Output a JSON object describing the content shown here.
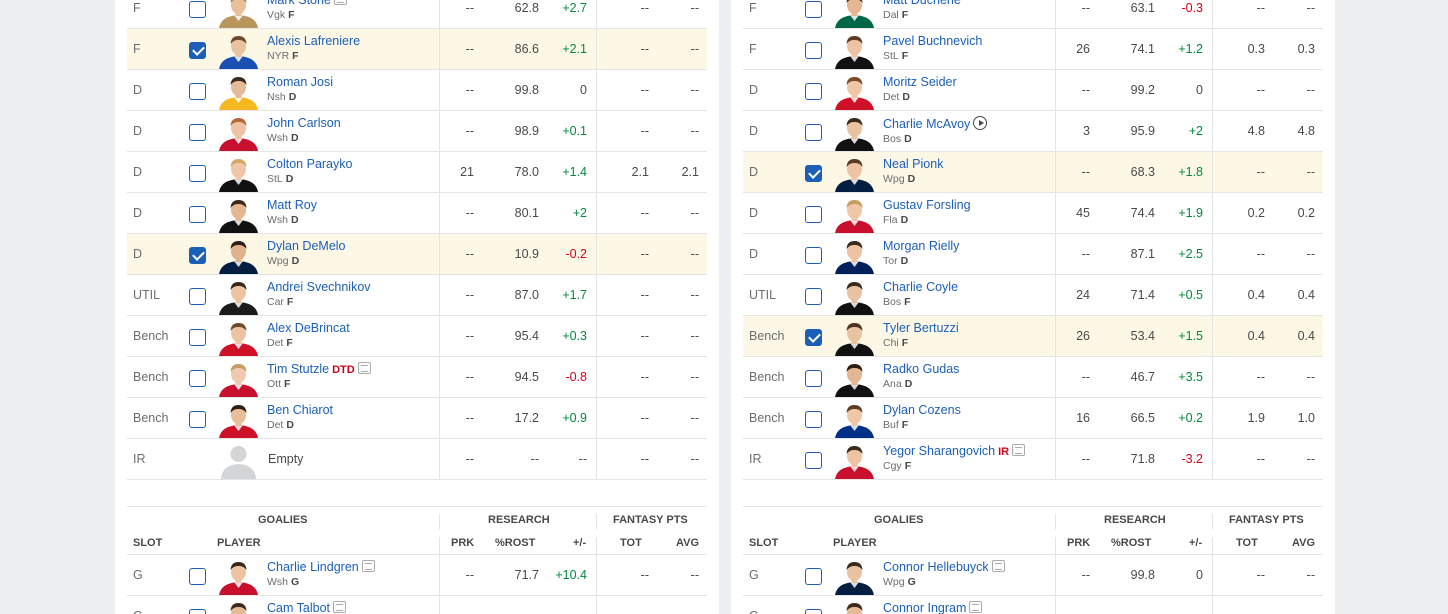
{
  "left": {
    "rows": [
      {
        "slot": "F",
        "name": "Mark Stone",
        "team": "Vgk",
        "pos": "F",
        "checked": false,
        "news": true,
        "prk": "--",
        "rost": "62.8",
        "pm": "+2.7",
        "tot": "--",
        "avg": "--",
        "jersey": "#b9975b",
        "skin": "#e7bf9b",
        "hair": "#a87d50"
      },
      {
        "slot": "F",
        "name": "Alexis Lafreniere",
        "team": "NYR",
        "pos": "F",
        "checked": true,
        "prk": "--",
        "rost": "86.6",
        "pm": "+2.1",
        "tot": "--",
        "avg": "--",
        "jersey": "#1a4fb3",
        "skin": "#e9c2a1",
        "hair": "#6e4a2d"
      },
      {
        "slot": "D",
        "name": "Roman Josi",
        "team": "Nsh",
        "pos": "D",
        "checked": false,
        "prk": "--",
        "rost": "99.8",
        "pm": "0",
        "tot": "--",
        "avg": "--",
        "jersey": "#f5b820",
        "skin": "#e5bb97",
        "hair": "#3b2a1e"
      },
      {
        "slot": "D",
        "name": "John Carlson",
        "team": "Wsh",
        "pos": "D",
        "checked": false,
        "prk": "--",
        "rost": "98.9",
        "pm": "+0.1",
        "tot": "--",
        "avg": "--",
        "jersey": "#c8102e",
        "skin": "#eec3a3",
        "hair": "#b46a35"
      },
      {
        "slot": "D",
        "name": "Colton Parayko",
        "team": "StL",
        "pos": "D",
        "checked": false,
        "prk": "21",
        "rost": "78.0",
        "pm": "+1.4",
        "tot": "2.1",
        "avg": "2.1",
        "jersey": "#111111",
        "skin": "#efc7a6",
        "hair": "#d6a968"
      },
      {
        "slot": "D",
        "name": "Matt Roy",
        "team": "Wsh",
        "pos": "D",
        "checked": false,
        "prk": "--",
        "rost": "80.1",
        "pm": "+2",
        "tot": "--",
        "avg": "--",
        "jersey": "#111111",
        "skin": "#e4b692",
        "hair": "#3a2a1d"
      },
      {
        "slot": "D",
        "name": "Dylan DeMelo",
        "team": "Wpg",
        "pos": "D",
        "checked": true,
        "prk": "--",
        "rost": "10.9",
        "pm": "-0.2",
        "tot": "--",
        "avg": "--",
        "jersey": "#041e42",
        "skin": "#e1b18d",
        "hair": "#2d1f14"
      },
      {
        "slot": "UTIL",
        "name": "Andrei Svechnikov",
        "team": "Car",
        "pos": "F",
        "checked": false,
        "prk": "--",
        "rost": "87.0",
        "pm": "+1.7",
        "tot": "--",
        "avg": "--",
        "jersey": "#1b1b1b",
        "skin": "#eec3a3",
        "hair": "#3a2a1d"
      },
      {
        "slot": "Bench",
        "name": "Alex DeBrincat",
        "team": "Det",
        "pos": "F",
        "checked": false,
        "prk": "--",
        "rost": "95.4",
        "pm": "+0.3",
        "tot": "--",
        "avg": "--",
        "jersey": "#ce1126",
        "skin": "#eec3a3",
        "hair": "#6e4a2d"
      },
      {
        "slot": "Bench",
        "name": "Tim Stutzle",
        "team": "Ott",
        "pos": "F",
        "checked": false,
        "status": "DTD",
        "news": true,
        "prk": "--",
        "rost": "94.5",
        "pm": "-0.8",
        "tot": "--",
        "avg": "--",
        "jersey": "#c8102e",
        "skin": "#f0cab0",
        "hair": "#c89b62"
      },
      {
        "slot": "Bench",
        "name": "Ben Chiarot",
        "team": "Det",
        "pos": "D",
        "checked": false,
        "prk": "--",
        "rost": "17.2",
        "pm": "+0.9",
        "tot": "--",
        "avg": "--",
        "jersey": "#ce1126",
        "skin": "#e8bd98",
        "hair": "#2d1f14"
      },
      {
        "slot": "IR",
        "empty": true,
        "name": "Empty",
        "prk": "--",
        "rost": "--",
        "pm": "--",
        "tot": "--",
        "avg": "--"
      }
    ],
    "goalie_header": {
      "section": "GOALIES",
      "research": "RESEARCH",
      "fantasy": "FANTASY PTS",
      "slot": "SLOT",
      "player": "PLAYER",
      "prk": "PRK",
      "rost": "%ROST",
      "pm": "+/-",
      "tot": "TOT",
      "avg": "AVG"
    },
    "goalies": [
      {
        "slot": "G",
        "name": "Charlie Lindgren",
        "team": "Wsh",
        "pos": "G",
        "checked": false,
        "news": true,
        "prk": "--",
        "rost": "71.7",
        "pm": "+10.4",
        "tot": "--",
        "avg": "--",
        "jersey": "#c8102e",
        "skin": "#eec3a3",
        "hair": "#3a2a1d"
      },
      {
        "slot": "G",
        "name": "Cam Talbot",
        "team": "",
        "pos": "",
        "checked": false,
        "news": true,
        "prk": "",
        "rost": "",
        "pm": "",
        "tot": "",
        "avg": "",
        "jersey": "#ce1126",
        "skin": "#e5bb97",
        "hair": "#3a2a1d"
      }
    ]
  },
  "right": {
    "rows": [
      {
        "slot": "F",
        "name": "Matt Duchene",
        "team": "Dal",
        "pos": "F",
        "checked": false,
        "prk": "--",
        "rost": "63.1",
        "pm": "-0.3",
        "tot": "--",
        "avg": "--",
        "jersey": "#006847",
        "skin": "#e4b692",
        "hair": "#3a2a1d"
      },
      {
        "slot": "F",
        "name": "Pavel Buchnevich",
        "team": "StL",
        "pos": "F",
        "checked": false,
        "prk": "26",
        "rost": "74.1",
        "pm": "+1.2",
        "tot": "0.3",
        "avg": "0.3",
        "jersey": "#111111",
        "skin": "#eec3a3",
        "hair": "#5a3d26"
      },
      {
        "slot": "D",
        "name": "Moritz Seider",
        "team": "Det",
        "pos": "D",
        "checked": false,
        "prk": "--",
        "rost": "99.2",
        "pm": "0",
        "tot": "--",
        "avg": "--",
        "jersey": "#ce1126",
        "skin": "#efc7a6",
        "hair": "#7a4a2a"
      },
      {
        "slot": "D",
        "name": "Charlie McAvoy",
        "team": "Bos",
        "pos": "D",
        "checked": false,
        "video": true,
        "prk": "3",
        "rost": "95.9",
        "pm": "+2",
        "tot": "4.8",
        "avg": "4.8",
        "jersey": "#111111",
        "skin": "#e9c2a1",
        "hair": "#3a2a1d"
      },
      {
        "slot": "D",
        "name": "Neal Pionk",
        "team": "Wpg",
        "pos": "D",
        "checked": true,
        "prk": "--",
        "rost": "68.3",
        "pm": "+1.8",
        "tot": "--",
        "avg": "--",
        "jersey": "#041e42",
        "skin": "#eec3a3",
        "hair": "#5a3d26"
      },
      {
        "slot": "D",
        "name": "Gustav Forsling",
        "team": "Fla",
        "pos": "D",
        "checked": false,
        "prk": "45",
        "rost": "74.4",
        "pm": "+1.9",
        "tot": "0.2",
        "avg": "0.2",
        "jersey": "#c8102e",
        "skin": "#efc7a6",
        "hair": "#c89b62"
      },
      {
        "slot": "D",
        "name": "Morgan Rielly",
        "team": "Tor",
        "pos": "D",
        "checked": false,
        "prk": "--",
        "rost": "87.1",
        "pm": "+2.5",
        "tot": "--",
        "avg": "--",
        "jersey": "#00205b",
        "skin": "#eec3a3",
        "hair": "#3a2a1d"
      },
      {
        "slot": "UTIL",
        "name": "Charlie Coyle",
        "team": "Bos",
        "pos": "F",
        "checked": false,
        "prk": "24",
        "rost": "71.4",
        "pm": "+0.5",
        "tot": "0.4",
        "avg": "0.4",
        "jersey": "#111111",
        "skin": "#e9c2a1",
        "hair": "#3a2a1d"
      },
      {
        "slot": "Bench",
        "name": "Tyler Bertuzzi",
        "team": "Chi",
        "pos": "F",
        "checked": true,
        "prk": "26",
        "rost": "53.4",
        "pm": "+1.5",
        "tot": "0.4",
        "avg": "0.4",
        "jersey": "#111111",
        "skin": "#e9c2a1",
        "hair": "#4a3322"
      },
      {
        "slot": "Bench",
        "name": "Radko Gudas",
        "team": "Ana",
        "pos": "D",
        "checked": false,
        "prk": "--",
        "rost": "46.7",
        "pm": "+3.5",
        "tot": "--",
        "avg": "--",
        "jersey": "#111111",
        "skin": "#e4b692",
        "hair": "#2d1f14"
      },
      {
        "slot": "Bench",
        "name": "Dylan Cozens",
        "team": "Buf",
        "pos": "F",
        "checked": false,
        "prk": "16",
        "rost": "66.5",
        "pm": "+0.2",
        "tot": "1.9",
        "avg": "1.0",
        "jersey": "#003087",
        "skin": "#efc7a6",
        "hair": "#5a3d26"
      },
      {
        "slot": "IR",
        "name": "Yegor Sharangovich",
        "team": "Cgy",
        "pos": "F",
        "checked": false,
        "status": "IR",
        "news": true,
        "prk": "--",
        "rost": "71.8",
        "pm": "-3.2",
        "tot": "--",
        "avg": "--",
        "jersey": "#c8102e",
        "skin": "#eec3a3",
        "hair": "#3a2a1d"
      }
    ],
    "goalie_header": {
      "section": "GOALIES",
      "research": "RESEARCH",
      "fantasy": "FANTASY PTS",
      "slot": "SLOT",
      "player": "PLAYER",
      "prk": "PRK",
      "rost": "%ROST",
      "pm": "+/-",
      "tot": "TOT",
      "avg": "AVG"
    },
    "goalies": [
      {
        "slot": "G",
        "name": "Connor Hellebuyck",
        "team": "Wpg",
        "pos": "G",
        "checked": false,
        "news": true,
        "prk": "--",
        "rost": "99.8",
        "pm": "0",
        "tot": "--",
        "avg": "--",
        "jersey": "#041e42",
        "skin": "#e9c2a1",
        "hair": "#3a2a1d"
      },
      {
        "slot": "G",
        "name": "Connor Ingram",
        "team": "",
        "pos": "",
        "checked": false,
        "news": true,
        "prk": "",
        "rost": "",
        "pm": "",
        "tot": "",
        "avg": "",
        "jersey": "#111111",
        "skin": "#e5bb97",
        "hair": "#3a2a1d"
      }
    ]
  }
}
